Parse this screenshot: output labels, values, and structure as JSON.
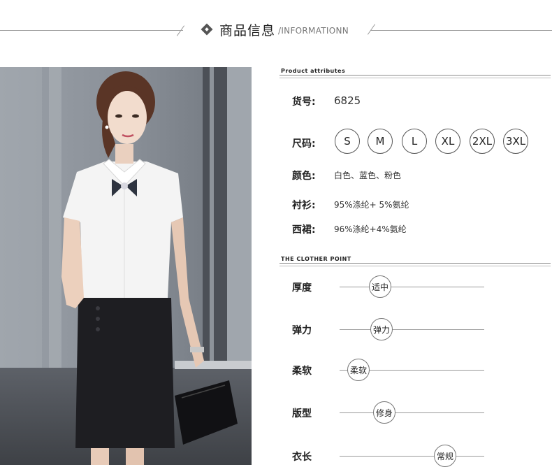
{
  "header": {
    "title": "商品信息",
    "subtitle": "/INFORMATIONN"
  },
  "attributes": {
    "section_label": "Product attributes",
    "item_no": {
      "label": "货号:",
      "value": "6825"
    },
    "size": {
      "label": "尺码:",
      "options": [
        "S",
        "M",
        "L",
        "XL",
        "2XL",
        "3XL"
      ]
    },
    "color": {
      "label": "颜色:",
      "value": "白色、蓝色、粉色"
    },
    "shirt": {
      "label": "衬衫:",
      "value": "95%涤纶+ 5%氨纶"
    },
    "skirt": {
      "label": "西裙:",
      "value": "96%涤纶+4%氨纶"
    }
  },
  "points": {
    "section_label": "THE CLOTHER POINT",
    "items": [
      {
        "label": "厚度",
        "value": "适中",
        "level": 0.28
      },
      {
        "label": "弹力",
        "value": "弹力",
        "level": 0.29
      },
      {
        "label": "柔软",
        "value": "柔软",
        "level": 0.13
      },
      {
        "label": "版型",
        "value": "修身",
        "level": 0.31
      },
      {
        "label": "衣长",
        "value": "常规",
        "level": 0.73
      }
    ]
  },
  "colors": {
    "text": "#222222",
    "rule": "#999999",
    "photo_bg": "#7a8089",
    "shirt": "#f4f4f4",
    "skirt": "#1e1e22"
  },
  "photo": {
    "icon": "model-photo"
  }
}
